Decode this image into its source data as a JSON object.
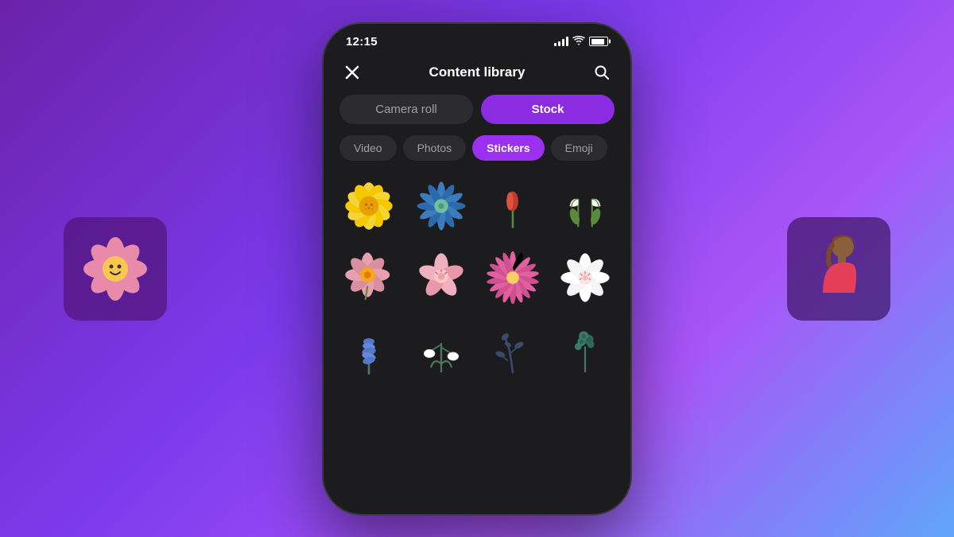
{
  "background": {
    "gradient_start": "#6b21a8",
    "gradient_end": "#60a5fa"
  },
  "status_bar": {
    "time": "12:15",
    "signal_aria": "signal bars",
    "wifi_aria": "wifi",
    "battery_aria": "battery"
  },
  "header": {
    "title": "Content library",
    "close_label": "×",
    "search_label": "🔍"
  },
  "tabs_main": [
    {
      "id": "camera-roll",
      "label": "Camera roll",
      "active": false
    },
    {
      "id": "stock",
      "label": "Stock",
      "active": true
    }
  ],
  "tabs_sub": [
    {
      "id": "video",
      "label": "Video",
      "active": false
    },
    {
      "id": "photos",
      "label": "Photos",
      "active": false
    },
    {
      "id": "stickers",
      "label": "Stickers",
      "active": true
    },
    {
      "id": "emoji",
      "label": "Emoji",
      "active": false
    }
  ],
  "stickers": [
    {
      "id": "yellow-flower",
      "alt": "Yellow daisy flower"
    },
    {
      "id": "blue-star-flower",
      "alt": "Blue star flower"
    },
    {
      "id": "red-tulip",
      "alt": "Red tulip bud"
    },
    {
      "id": "snowdrop",
      "alt": "Snowdrop flowers"
    },
    {
      "id": "pink-wildflower",
      "alt": "Pink wildflower"
    },
    {
      "id": "pink-blossom",
      "alt": "Pink cherry blossom"
    },
    {
      "id": "pink-daisy",
      "alt": "Pink daisy"
    },
    {
      "id": "white-flower",
      "alt": "White flower"
    },
    {
      "id": "blue-spike",
      "alt": "Blue flower spike"
    },
    {
      "id": "snowdrop2",
      "alt": "Snowdrop plant"
    },
    {
      "id": "dark-branch",
      "alt": "Dark leaf branch"
    },
    {
      "id": "teal-plant",
      "alt": "Teal plant"
    }
  ],
  "bg_card_left": {
    "alt": "Flower sticker preview",
    "emoji": "🌸"
  },
  "bg_card_right": {
    "alt": "Person silhouette preview"
  }
}
